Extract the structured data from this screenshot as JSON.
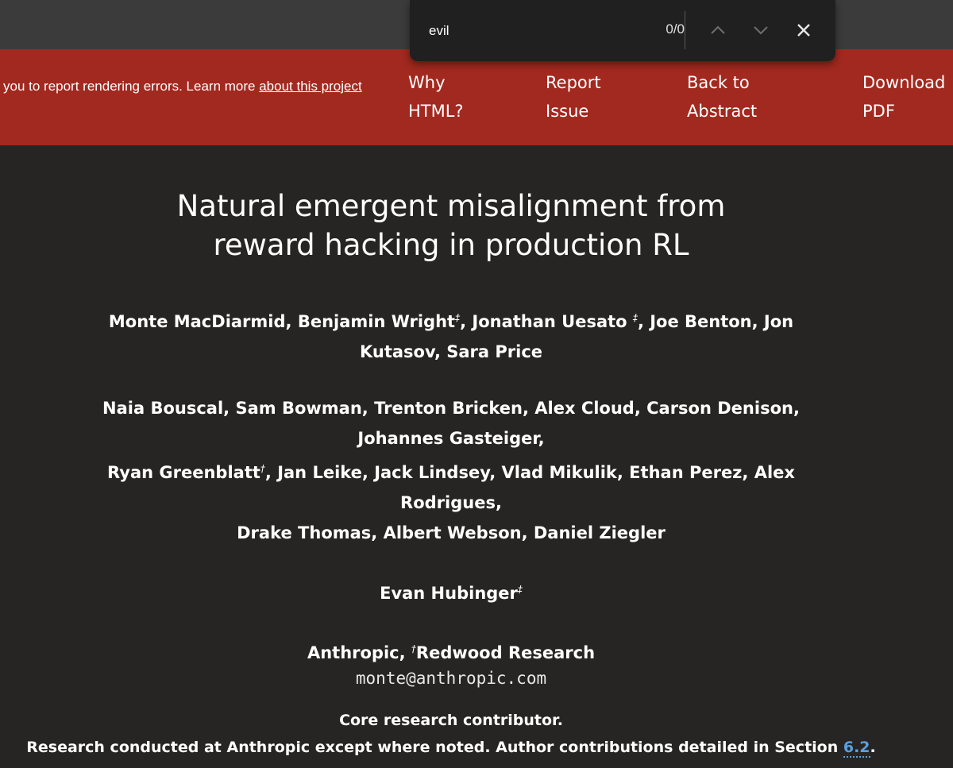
{
  "find_bar": {
    "query": "evil",
    "count": "0/0",
    "icons": {
      "prev": "chevron-up-icon",
      "next": "chevron-down-icon",
      "close": "close-icon"
    }
  },
  "banner": {
    "message": "you to report rendering errors. Learn more ",
    "message_link": "about this project",
    "nav": [
      {
        "line1": "Why",
        "line2": "HTML?"
      },
      {
        "line1": "Report",
        "line2": "Issue"
      },
      {
        "line1": "Back to",
        "line2": "Abstract"
      },
      {
        "line1": "Download",
        "line2": "PDF"
      }
    ],
    "color": "#a2291f"
  },
  "paper": {
    "title_line1": "Natural emergent misalignment from",
    "title_line2": "reward hacking in production RL",
    "authors_block1": {
      "line1_a": "Monte MacDiarmid, Benjamin Wright",
      "mark1": "‡",
      "line1_b": ", Jonathan Uesato ",
      "mark2": "‡",
      "line1_c": ", Joe Benton, Jon",
      "line2": "Kutasov, Sara Price"
    },
    "authors_block2": {
      "line1": "Naia Bouscal, Sam Bowman, Trenton Bricken, Alex Cloud, Carson Denison,",
      "line2": "Johannes Gasteiger,",
      "line3_a": "Ryan Greenblatt",
      "line3_mark": "†",
      "line3_b": ", Jan Leike, Jack Lindsey, Vlad Mikulik, Ethan Perez, Alex",
      "line4": "Rodrigues,",
      "line5": "Drake Thomas, Albert Webson, Daniel Ziegler"
    },
    "authors_block3": {
      "name": "Evan Hubinger",
      "mark": "‡"
    },
    "affiliation": {
      "part1": "Anthropic, ",
      "mark": "†",
      "part2": "Redwood Research"
    },
    "email": "monte@anthropic.com",
    "notes": {
      "line1": "Core research contributor.",
      "line2": "Research conducted at Anthropic except where noted. Author contributions detailed in Section ",
      "section_link": "6.2",
      "line2_end": "."
    }
  }
}
